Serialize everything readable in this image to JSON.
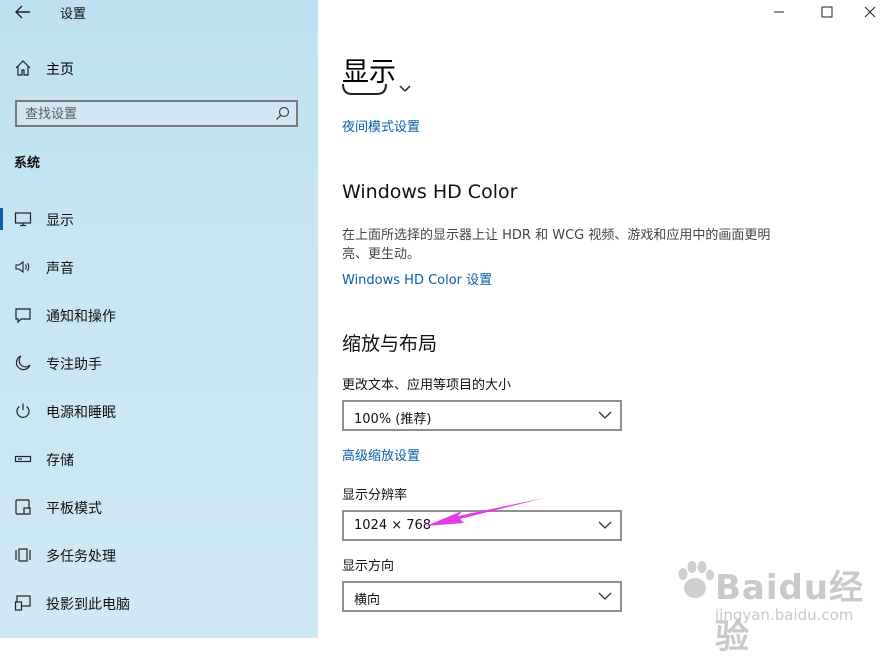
{
  "window": {
    "title": "设置"
  },
  "sidebar": {
    "home_label": "主页",
    "search_placeholder": "查找设置",
    "section_label": "系统",
    "items": [
      {
        "label": "显示",
        "icon": "monitor-icon",
        "active": true
      },
      {
        "label": "声音",
        "icon": "speaker-icon"
      },
      {
        "label": "通知和操作",
        "icon": "notification-icon"
      },
      {
        "label": "专注助手",
        "icon": "moon-icon"
      },
      {
        "label": "电源和睡眠",
        "icon": "power-icon"
      },
      {
        "label": "存储",
        "icon": "storage-icon"
      },
      {
        "label": "平板模式",
        "icon": "tablet-icon"
      },
      {
        "label": "多任务处理",
        "icon": "multitask-icon"
      },
      {
        "label": "投影到此电脑",
        "icon": "project-icon"
      }
    ]
  },
  "main": {
    "title": "显示",
    "night_light_link": "夜间模式设置",
    "hdr": {
      "heading": "Windows HD Color",
      "description": "在上面所选择的显示器上让 HDR 和 WCG 视频、游戏和应用中的画面更明亮、更生动。",
      "link": "Windows HD Color 设置"
    },
    "scale": {
      "heading": "缩放与布局",
      "text_size_label": "更改文本、应用等项目的大小",
      "text_size_value": "100% (推荐)",
      "advanced_link": "高级缩放设置",
      "resolution_label": "显示分辨率",
      "resolution_value": "1024 × 768",
      "orientation_label": "显示方向",
      "orientation_value": "横向"
    }
  },
  "watermark": {
    "brand": "Baidu经验",
    "url": "jingyan.baidu.com"
  },
  "colors": {
    "accent": "#0a5fa8",
    "sidebar": "#c9e6f4",
    "annotation": "#e53be5"
  }
}
